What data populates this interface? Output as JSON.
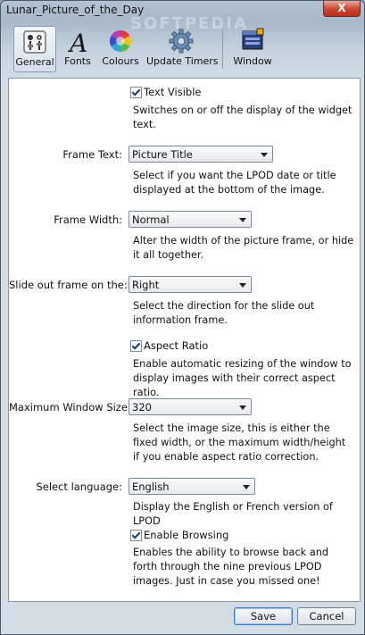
{
  "window": {
    "title": "Lunar_Picture_of_the_Day",
    "watermark": "SOFTPEDIA",
    "close_glyph": "X"
  },
  "toolbar": {
    "tabs": [
      {
        "label": "General",
        "icon": "general-settings-icon"
      },
      {
        "label": "Fonts",
        "icon": "font-icon"
      },
      {
        "label": "Colours",
        "icon": "color-wheel-icon"
      },
      {
        "label": "Update Timers",
        "icon": "gear-icon"
      },
      {
        "label": "Window",
        "icon": "window-icon"
      }
    ],
    "active": "General"
  },
  "settings": {
    "text_visible": {
      "label": "Text Visible",
      "checked": true,
      "description": "Switches on or off the display of the widget text."
    },
    "frame_text": {
      "label": "Frame Text:",
      "value": "Picture Title",
      "description": "Select if you want the LPOD date or title displayed at the bottom of the image."
    },
    "frame_width": {
      "label": "Frame Width:",
      "value": "Normal",
      "description": "Alter the width of the picture frame, or hide it all together."
    },
    "slide_out": {
      "label": "Slide out frame on the:",
      "value": "Right",
      "description": "Select the direction for the slide out information frame."
    },
    "aspect_ratio": {
      "label": "Aspect Ratio",
      "checked": true,
      "description": "Enable automatic resizing of the window to display images with their correct aspect ratio."
    },
    "max_window_size": {
      "label": "Maximum Window Size:",
      "value": "320",
      "description": "Select the image size, this is either the fixed width, or the maximum width/height if you enable aspect ratio correction."
    },
    "language": {
      "label": "Select language:",
      "value": "English",
      "description": "Display the English or French version of LPOD"
    },
    "browsing": {
      "label": "Enable Browsing",
      "checked": true,
      "description": "Enables the ability to browse back and forth through the nine previous LPOD images. Just in case you missed one!"
    }
  },
  "footer": {
    "save_label": "Save",
    "cancel_label": "Cancel"
  }
}
